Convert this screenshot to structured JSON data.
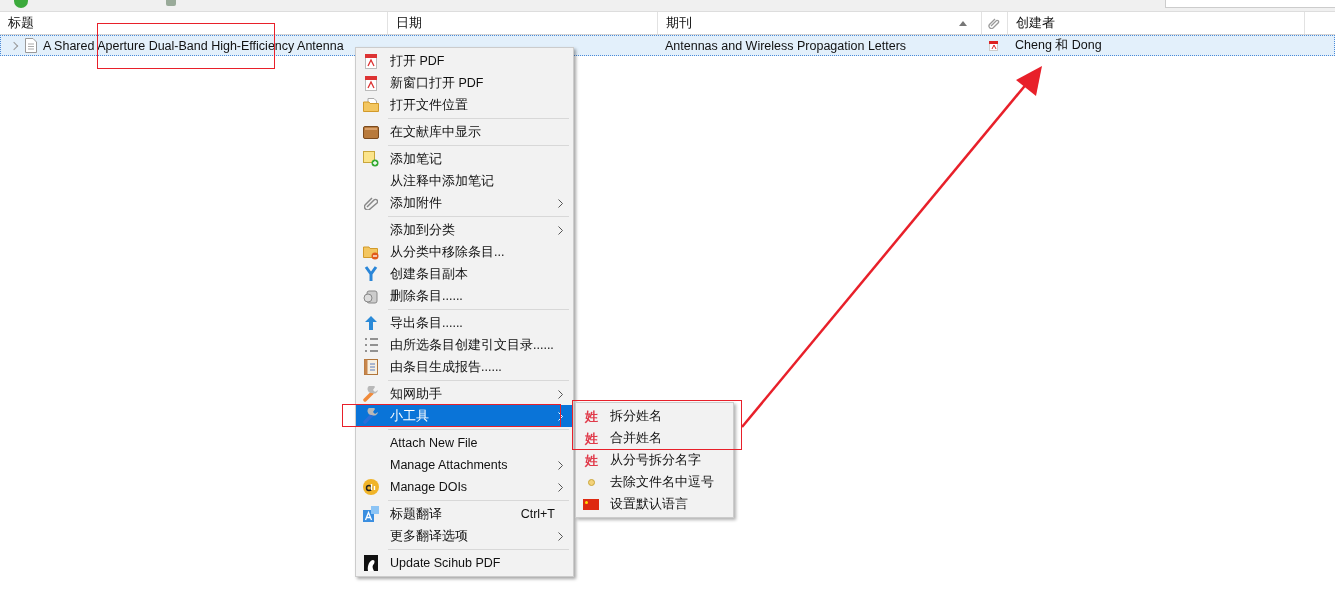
{
  "table": {
    "columns": [
      {
        "label": "标题"
      },
      {
        "label": "日期"
      },
      {
        "label": "期刊",
        "sorted": true
      },
      {
        "kind": "attachment"
      },
      {
        "label": "创建者"
      }
    ],
    "rows": [
      {
        "title": "A Shared Aperture Dual-Band High-Efficiency Antenna",
        "date": "",
        "journal": "Antennas and Wireless Propagation Letters",
        "has_pdf": true,
        "creator": "Cheng 和 Dong",
        "selected": true,
        "expanded": false
      }
    ]
  },
  "context_menu": {
    "items": [
      {
        "kind": "item",
        "label": "打开 PDF"
      },
      {
        "kind": "item",
        "label": "新窗口打开 PDF"
      },
      {
        "kind": "item",
        "label": "打开文件位置"
      },
      {
        "kind": "separator"
      },
      {
        "kind": "item",
        "label": "在文献库中显示"
      },
      {
        "kind": "separator"
      },
      {
        "kind": "item",
        "label": "添加笔记"
      },
      {
        "kind": "item",
        "label": "从注释中添加笔记"
      },
      {
        "kind": "item",
        "label": "添加附件",
        "submenu": true
      },
      {
        "kind": "separator"
      },
      {
        "kind": "item",
        "label": "添加到分类",
        "submenu": true
      },
      {
        "kind": "item",
        "label": "从分类中移除条目..."
      },
      {
        "kind": "item",
        "label": "创建条目副本"
      },
      {
        "kind": "item",
        "label": "删除条目......"
      },
      {
        "kind": "separator"
      },
      {
        "kind": "item",
        "label": "导出条目......"
      },
      {
        "kind": "item",
        "label": "由所选条目创建引文目录......"
      },
      {
        "kind": "item",
        "label": "由条目生成报告......"
      },
      {
        "kind": "separator"
      },
      {
        "kind": "item",
        "label": "知网助手",
        "submenu": true
      },
      {
        "kind": "item",
        "label": "小工具",
        "submenu": true,
        "selected": true
      },
      {
        "kind": "separator"
      },
      {
        "kind": "item",
        "label": "Attach New File"
      },
      {
        "kind": "item",
        "label": "Manage Attachments",
        "submenu": true
      },
      {
        "kind": "item",
        "label": "Manage DOIs",
        "submenu": true
      },
      {
        "kind": "separator"
      },
      {
        "kind": "item",
        "label": "标题翻译",
        "shortcut": "Ctrl+T"
      },
      {
        "kind": "item",
        "label": "更多翻译选项",
        "submenu": true
      },
      {
        "kind": "separator"
      },
      {
        "kind": "item",
        "label": "Update Scihub PDF"
      }
    ]
  },
  "submenu": {
    "items": [
      {
        "label": "拆分姓名",
        "glyph": "姓"
      },
      {
        "label": "合并姓名",
        "glyph": "姓"
      },
      {
        "label": "从分号拆分名字",
        "glyph": "姓"
      },
      {
        "label": "去除文件名中逗号"
      },
      {
        "label": "设置默认语言"
      }
    ]
  }
}
